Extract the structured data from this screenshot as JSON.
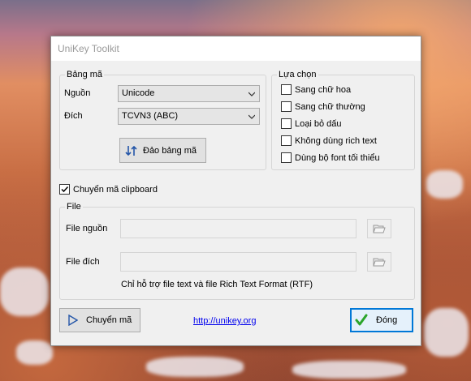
{
  "dialog": {
    "title": "UniKey Toolkit",
    "charset_group": {
      "legend": "Bảng mã",
      "source_label": "Nguồn",
      "source_value": "Unicode",
      "target_label": "Đích",
      "target_value": "TCVN3 (ABC)",
      "swap_label": "Đảo bảng mã"
    },
    "options_group": {
      "legend": "Lựa chọn",
      "items": [
        {
          "label": "Sang chữ hoa",
          "checked": false
        },
        {
          "label": "Sang chữ thường",
          "checked": false
        },
        {
          "label": "Loại bỏ dấu",
          "checked": false
        },
        {
          "label": "Không dùng rich text",
          "checked": false
        },
        {
          "label": "Dùng bộ font tối thiểu",
          "checked": false
        }
      ]
    },
    "clipboard": {
      "label": "Chuyển mã clipboard",
      "checked": true
    },
    "file_group": {
      "legend": "File",
      "source_label": "File nguồn",
      "source_value": "",
      "target_label": "File đích",
      "target_value": "",
      "note": "Chỉ hỗ trợ file text và file Rich Text Format (RTF)"
    },
    "convert_label": "Chuyển mã",
    "link_text": "http://unikey.org",
    "close_label": "Đóng"
  },
  "colors": {
    "accent": "#0078d7",
    "check_green": "#2ba52b",
    "link": "#0000ee"
  }
}
